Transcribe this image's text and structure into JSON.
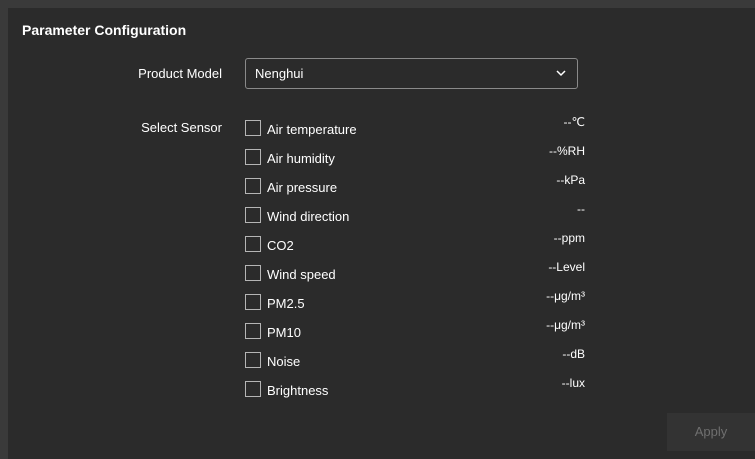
{
  "panel": {
    "title": "Parameter Configuration"
  },
  "product_model": {
    "label": "Product Model",
    "selected": "Nenghui",
    "icon": "chevron-down-icon"
  },
  "sensors": {
    "label": "Select Sensor",
    "items": [
      {
        "name": "Air temperature",
        "value": "--℃",
        "checked": false
      },
      {
        "name": "Air humidity",
        "value": "--%RH",
        "checked": false
      },
      {
        "name": "Air pressure",
        "value": "--kPa",
        "checked": false
      },
      {
        "name": "Wind direction",
        "value": "--",
        "checked": false
      },
      {
        "name": "CO2",
        "value": "--ppm",
        "checked": false
      },
      {
        "name": "Wind speed",
        "value": "--Level",
        "checked": false
      },
      {
        "name": "PM2.5",
        "value": "--μg/m³",
        "checked": false
      },
      {
        "name": "PM10",
        "value": "--μg/m³",
        "checked": false
      },
      {
        "name": "Noise",
        "value": "--dB",
        "checked": false
      },
      {
        "name": "Brightness",
        "value": "--lux",
        "checked": false
      }
    ]
  },
  "actions": {
    "apply_label": "Apply",
    "apply_enabled": false
  },
  "colors": {
    "background": "#2b2b2b",
    "outer": "#3a3a3a",
    "text": "#ffffff",
    "disabled_text": "#6f6f6f"
  }
}
